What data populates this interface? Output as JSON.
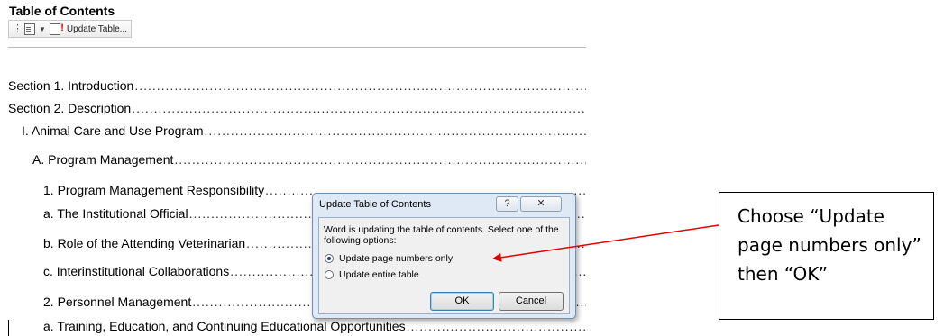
{
  "document": {
    "heading": "Table of Contents",
    "toolbar": {
      "update_button_label": "Update Table..."
    },
    "toc": [
      {
        "label": "Section 1.  Introduction",
        "indent": 0
      },
      {
        "label": "Section 2.  Description ",
        "indent": 0
      },
      {
        "label": "I.   Animal Care and Use Program ",
        "indent": 1
      },
      {
        "label": "A.  Program Management",
        "indent": 2
      },
      {
        "label": "1.  Program Management Responsibility",
        "indent": 3
      },
      {
        "label": "a.  The Institutional Official",
        "indent": 3
      },
      {
        "label": "b.  Role of the Attending Veterinarian ",
        "indent": 3
      },
      {
        "label": "c.  Interinstitutional Collaborations ",
        "indent": 3
      },
      {
        "label": "2.  Personnel Management",
        "indent": 3
      },
      {
        "label": "a.  Training, Education, and Continuing Educational Opportunities",
        "indent": 3
      }
    ]
  },
  "dialog": {
    "title": "Update Table of Contents",
    "help_label": "?",
    "close_label": "✕",
    "message": "Word is updating the table of contents.  Select one of the following options:",
    "options": [
      {
        "label": "Update page numbers only",
        "selected": true
      },
      {
        "label": "Update entire table",
        "selected": false
      }
    ],
    "ok_label": "OK",
    "cancel_label": "Cancel"
  },
  "callout": {
    "text": "Choose “Update page numbers only” then “OK”"
  },
  "colors": {
    "arrow": "#e00000",
    "dialog_bg": "#dfe9f5"
  }
}
